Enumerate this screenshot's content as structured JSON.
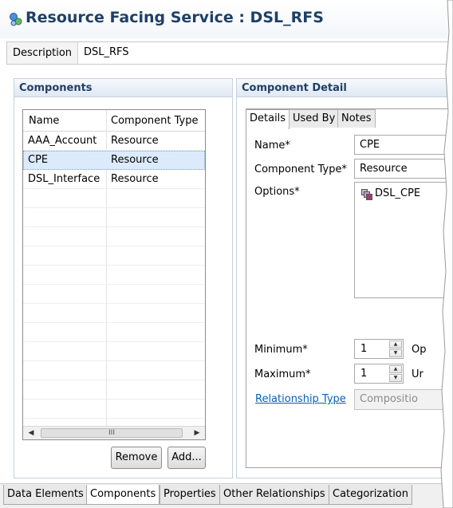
{
  "header": {
    "title": "Resource Facing Service : DSL_RFS",
    "icon": "resource-facing-service-icon"
  },
  "description": {
    "label": "Description",
    "value": "DSL_RFS"
  },
  "components": {
    "header": "Components",
    "columns": [
      "Name",
      "Component Type"
    ],
    "rows": [
      {
        "name": "AAA_Account",
        "type": "Resource"
      },
      {
        "name": "CPE",
        "type": "Resource",
        "selected": true
      },
      {
        "name": "DSL_Interface",
        "type": "Resource"
      }
    ],
    "scroll_grip": "III",
    "remove_label": "Remove",
    "add_label": "Add..."
  },
  "detail": {
    "header": "Component Detail",
    "tabs": [
      "Details",
      "Used By",
      "Notes"
    ],
    "active_tab": "Details",
    "name_label": "Name*",
    "name_value": "CPE",
    "type_label": "Component Type*",
    "type_value": "Resource",
    "options_label": "Options*",
    "options": [
      "DSL_CPE"
    ],
    "minimum_label": "Minimum*",
    "minimum_value": "1",
    "minimum_after": "Op",
    "maximum_label": "Maximum*",
    "maximum_value": "1",
    "maximum_after": "Ur",
    "relationship_label": "Relationship Type",
    "relationship_value": "Compositio"
  },
  "bottom_tabs": [
    "Data Elements",
    "Components",
    "Properties",
    "Other Relationships",
    "Categorization"
  ],
  "active_bottom_tab": "Components",
  "colors": {
    "title": "#1f3f66",
    "link": "#0b5fb5",
    "selection": "#dcebfc"
  }
}
